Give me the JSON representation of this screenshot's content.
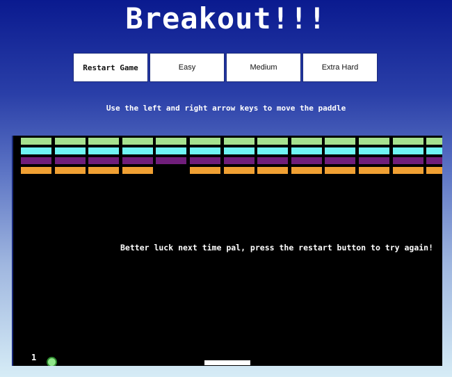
{
  "title": "Breakout!!!",
  "buttons": {
    "restart": "Restart Game",
    "easy": "Easy",
    "medium": "Medium",
    "extra_hard": "Extra Hard"
  },
  "instructions": "Use the left and right arrow keys to move the paddle",
  "game": {
    "message": "Better luck next time pal, press the restart button to try again!",
    "lives": "1",
    "colors": {
      "background": "#000000",
      "paddle": "#ffffff",
      "ball": "#8fe68a"
    },
    "brick_rows": [
      {
        "color": "#a6e28f",
        "present": [
          1,
          1,
          1,
          1,
          1,
          1,
          1,
          1,
          1,
          1,
          1,
          1,
          1
        ]
      },
      {
        "color": "#6ff5f5",
        "present": [
          1,
          1,
          1,
          1,
          1,
          1,
          1,
          1,
          1,
          1,
          1,
          1,
          1
        ]
      },
      {
        "color": "#701e7a",
        "present": [
          1,
          1,
          1,
          1,
          1,
          1,
          1,
          1,
          1,
          1,
          1,
          1,
          1
        ]
      },
      {
        "color": "#f0a033",
        "present": [
          1,
          1,
          1,
          1,
          0,
          1,
          1,
          1,
          1,
          1,
          1,
          1,
          1
        ]
      }
    ]
  }
}
